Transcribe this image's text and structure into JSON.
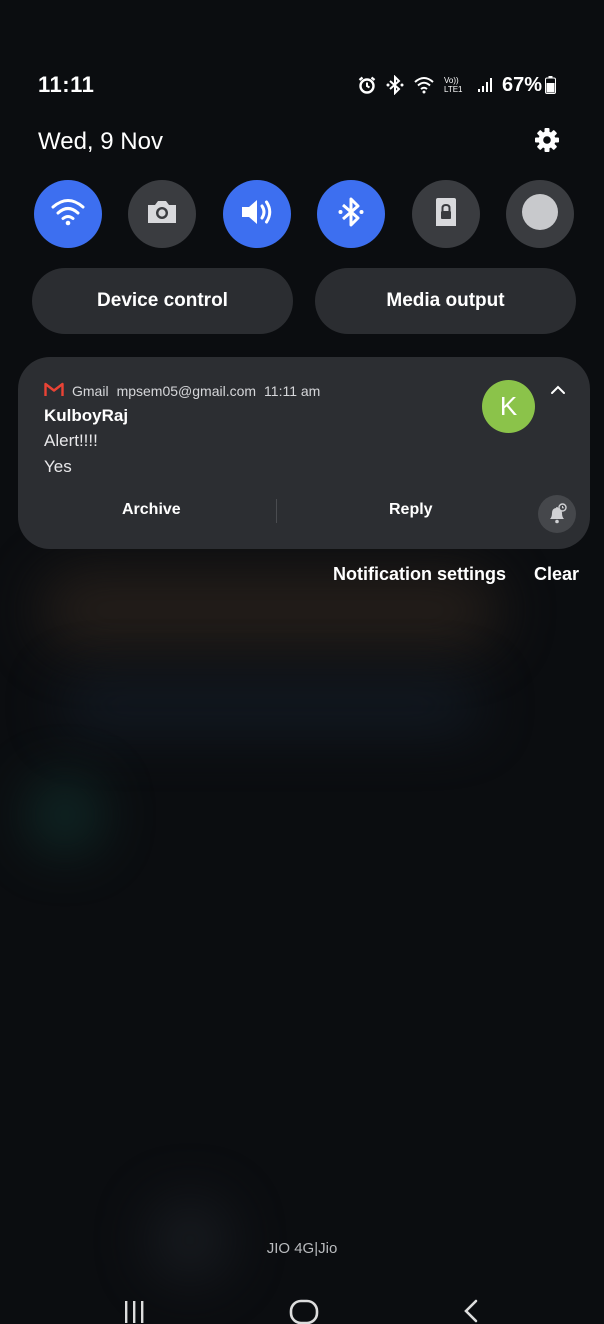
{
  "status_bar": {
    "time": "11:11",
    "battery": "67%",
    "network_label": "Vo)) LTE1",
    "icons": [
      "alarm-icon",
      "bluetooth-icon",
      "wifi-icon",
      "volte-icon",
      "signal-icon",
      "battery-icon"
    ]
  },
  "header": {
    "date": "Wed, 9 Nov",
    "settings_icon": "gear-icon"
  },
  "quick_toggles": [
    {
      "name": "wifi",
      "icon": "wifi-icon",
      "state": "on"
    },
    {
      "name": "camera",
      "icon": "camera-icon",
      "state": "off"
    },
    {
      "name": "sound",
      "icon": "volume-icon",
      "state": "on"
    },
    {
      "name": "bluetooth",
      "icon": "bluetooth-icon",
      "state": "on"
    },
    {
      "name": "secure-folder",
      "icon": "lock-icon",
      "state": "off"
    },
    {
      "name": "extra",
      "icon": "circle-icon",
      "state": "off"
    }
  ],
  "pills": {
    "device_control": "Device control",
    "media_output": "Media output"
  },
  "notification": {
    "app": "Gmail",
    "account": "mpsem05@gmail.com",
    "time": "11:11 am",
    "sender": "KulboyRaj",
    "subject": "Alert!!!!",
    "body": "Yes",
    "avatar_letter": "K",
    "actions": {
      "archive": "Archive",
      "reply": "Reply"
    }
  },
  "notification_links": {
    "settings": "Notification settings",
    "clear": "Clear"
  },
  "carrier": "JIO 4G|Jio",
  "colors": {
    "accent": "#3d6ff0",
    "avatar": "#8bc34a",
    "gmail_red": "#ea4335",
    "card": "#2c2e32"
  }
}
